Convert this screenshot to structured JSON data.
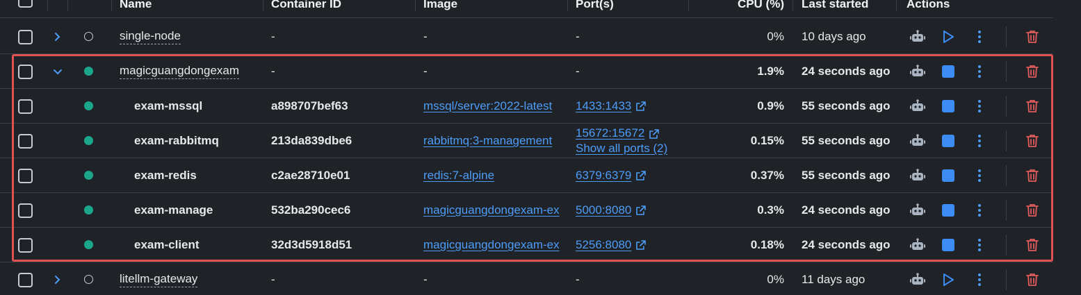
{
  "header": {
    "name": "Name",
    "container_id": "Container ID",
    "image": "Image",
    "ports": "Port(s)",
    "cpu": "CPU (%)",
    "last_started": "Last started",
    "actions": "Actions"
  },
  "rows": [
    {
      "name": "single-node",
      "container_id": "-",
      "image": "-",
      "port": "-",
      "cpu": "0%",
      "last": "10 days ago"
    },
    {
      "name": "magicguangdongexam",
      "container_id": "-",
      "image": "-",
      "port": "-",
      "cpu": "1.9%",
      "last": "24 seconds ago"
    },
    {
      "name": "exam-mssql",
      "container_id": "a898707bef63",
      "image": "mssql/server:2022-latest",
      "port": "1433:1433",
      "cpu": "0.9%",
      "last": "55 seconds ago"
    },
    {
      "name": "exam-rabbitmq",
      "container_id": "213da839dbe6",
      "image": "rabbitmq:3-management",
      "port": "15672:15672",
      "port_more": "Show all ports (2)",
      "cpu": "0.15%",
      "last": "55 seconds ago"
    },
    {
      "name": "exam-redis",
      "container_id": "c2ae28710e01",
      "image": "redis:7-alpine",
      "port": "6379:6379",
      "cpu": "0.37%",
      "last": "55 seconds ago"
    },
    {
      "name": "exam-manage",
      "container_id": "532ba290cec6",
      "image": "magicguangdongexam-ex",
      "port": "5000:8080",
      "cpu": "0.3%",
      "last": "24 seconds ago"
    },
    {
      "name": "exam-client",
      "container_id": "32d3d5918d51",
      "image": "magicguangdongexam-ex",
      "port": "5256:8080",
      "cpu": "0.18%",
      "last": "24 seconds ago"
    },
    {
      "name": "litellm-gateway",
      "container_id": "-",
      "image": "-",
      "port": "-",
      "cpu": "0%",
      "last": "11 days ago"
    }
  ],
  "icons": {
    "expand": "chevron-right-icon",
    "collapse": "chevron-down-icon",
    "status_running": "running-dot-icon",
    "status_stopped": "stopped-circle-icon",
    "debug": "robot-icon",
    "start": "play-icon",
    "stop": "stop-icon",
    "more": "kebab-menu-icon",
    "delete": "trash-icon",
    "open_port": "external-link-icon"
  },
  "colors": {
    "background": "#1f2328",
    "link": "#4d9cf8",
    "running": "#1ba58a",
    "delete": "#e25c5c",
    "highlight_border": "#e05252"
  }
}
